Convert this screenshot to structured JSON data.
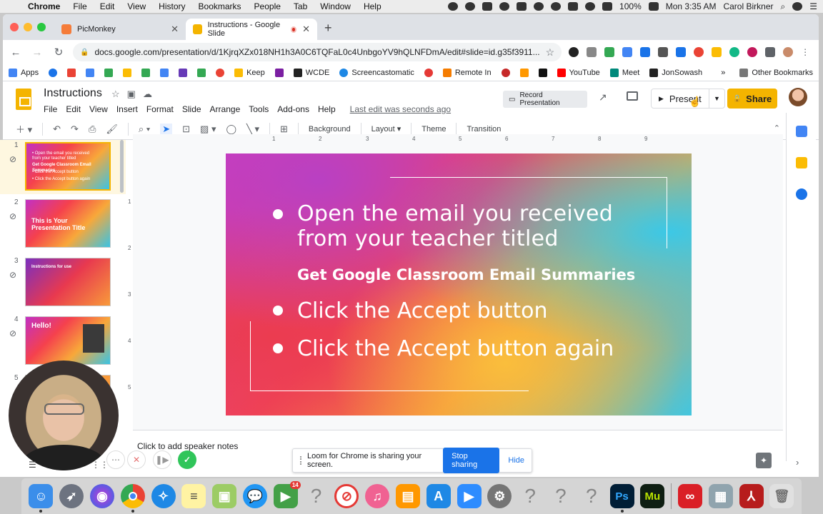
{
  "menubar": {
    "app": "Chrome",
    "items": [
      "File",
      "Edit",
      "View",
      "History",
      "Bookmarks",
      "People",
      "Tab",
      "Window",
      "Help"
    ],
    "battery": "100%",
    "clock": "Mon 3:35 AM",
    "user": "Carol Birkner"
  },
  "tabs": [
    {
      "title": "PicMonkey",
      "favicon_color": "#f57c3a"
    },
    {
      "title": "Instructions - Google Slide",
      "favicon_color": "#f4b400"
    }
  ],
  "address": {
    "url": "docs.google.com/presentation/d/1KjrqXZx018NH1h3A0C6TQFaL0c4UnbgoYV9hQLNFDmA/edit#slide=id.g35f3911..."
  },
  "bookmarks": {
    "items": [
      "Apps",
      "Keep",
      "WCDE",
      "Screencastomatic",
      "Remote In",
      "YouTube",
      "Meet",
      "JonSowash"
    ],
    "other": "Other Bookmarks",
    "more": "»"
  },
  "doc": {
    "title": "Instructions",
    "menu": [
      "File",
      "Edit",
      "View",
      "Insert",
      "Format",
      "Slide",
      "Arrange",
      "Tools",
      "Add-ons",
      "Help"
    ],
    "last_edit": "Last edit was seconds ago",
    "record_label": "Record Presentation",
    "present_label": "Present",
    "share_label": "Share"
  },
  "toolbar": {
    "background": "Background",
    "layout": "Layout",
    "theme": "Theme",
    "transition": "Transition"
  },
  "ruler": {
    "h": [
      "1",
      "2",
      "3",
      "4",
      "5",
      "6",
      "7",
      "8",
      "9"
    ],
    "v": [
      "1",
      "2",
      "3",
      "4",
      "5"
    ]
  },
  "thumbnails": [
    {
      "num": "1",
      "lines": [
        "• Open the email you received",
        "  from your teacher titled",
        "  Get Google Classroom Email Summaries",
        "• Click the Accept button",
        "• Click the Accept button again"
      ]
    },
    {
      "num": "2",
      "title": "This is Your Presentation Title"
    },
    {
      "num": "3",
      "title": "Instructions for use"
    },
    {
      "num": "4",
      "title": "Hello!"
    },
    {
      "num": "5"
    }
  ],
  "slide": {
    "line1a": "Open the email you received",
    "line1b": "from your teacher titled",
    "line2": "Get Google Classroom Email Summaries",
    "line3": "Click the Accept button",
    "line4": "Click the Accept button again"
  },
  "notes": {
    "placeholder": "Click to add speaker notes"
  },
  "loom": {
    "message": "Loom for Chrome is sharing your screen.",
    "stop": "Stop sharing",
    "hide": "Hide"
  },
  "dock": {
    "apps": [
      "Finder",
      "Launchpad",
      "Siri",
      "Chrome",
      "Safari",
      "Notes",
      "Preview",
      "Messages",
      "FaceTime",
      "?",
      "News",
      "Music",
      "Books",
      "App Store",
      "Zoom",
      "System Preferences",
      "?",
      "?",
      "?",
      "Ps",
      "Mu",
      "Creative Cloud",
      "Image Capture",
      "Acrobat",
      "Trash"
    ],
    "facetime_badge": "14"
  }
}
